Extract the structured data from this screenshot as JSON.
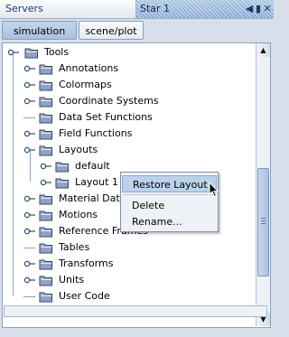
{
  "window": {
    "servers_title": "Servers",
    "star_title": "Star 1"
  },
  "tabs": [
    {
      "label": "simulation",
      "active": true
    },
    {
      "label": "scene/plot",
      "active": false
    }
  ],
  "tree": {
    "root": "Tools",
    "items": [
      {
        "label": "Annotations",
        "expandable": true
      },
      {
        "label": "Colormaps",
        "expandable": true
      },
      {
        "label": "Coordinate Systems",
        "expandable": true
      },
      {
        "label": "Data Set Functions",
        "expandable": false
      },
      {
        "label": "Field Functions",
        "expandable": true
      },
      {
        "label": "Layouts",
        "expandable": true,
        "expanded": true
      },
      {
        "label": "default",
        "expandable": true
      },
      {
        "label": "Layout 1",
        "expandable": true
      },
      {
        "label": "Material Data",
        "expandable": true
      },
      {
        "label": "Motions",
        "expandable": true
      },
      {
        "label": "Reference Frames",
        "expandable": true
      },
      {
        "label": "Tables",
        "expandable": false
      },
      {
        "label": "Transforms",
        "expandable": true
      },
      {
        "label": "Units",
        "expandable": true
      },
      {
        "label": "User Code",
        "expandable": false
      }
    ]
  },
  "context_menu": {
    "items": [
      "Restore Layout",
      "Delete",
      "Rename..."
    ],
    "highlighted": "Restore Layout"
  },
  "icons": {
    "folder": "folder-icon",
    "expand": "expand-handle-icon",
    "scroll_up": "scroll-up-arrow-icon",
    "scroll_down": "scroll-down-arrow-icon",
    "cursor": "mouse-pointer-icon"
  },
  "colors": {
    "accent": "#a8c1df",
    "title_active": "#86a8d3",
    "menu_highlight": "#bcd1ea",
    "folder_fill": "#a4b4d2"
  }
}
